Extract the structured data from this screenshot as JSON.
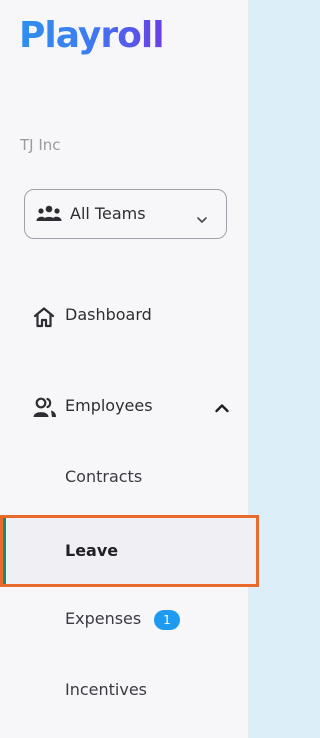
{
  "brand": {
    "name": "Playroll"
  },
  "org": {
    "name": "TJ Inc"
  },
  "team_select": {
    "value": "All Teams",
    "icon": "team-icon"
  },
  "nav": {
    "dashboard": {
      "label": "Dashboard",
      "icon": "home-icon"
    },
    "employees": {
      "label": "Employees",
      "icon": "people-icon",
      "expanded": true
    },
    "sub_items": {
      "contracts": {
        "label": "Contracts"
      },
      "leave": {
        "label": "Leave",
        "active": true
      },
      "expenses": {
        "label": "Expenses",
        "badge": "1"
      },
      "incentives": {
        "label": "Incentives"
      }
    }
  },
  "colors": {
    "brand_start": "#2f8ff0",
    "brand_end": "#6a3fe6",
    "active_outline": "#e86a2c",
    "active_bar": "#1e8a6a",
    "badge": "#1e9bf0"
  }
}
